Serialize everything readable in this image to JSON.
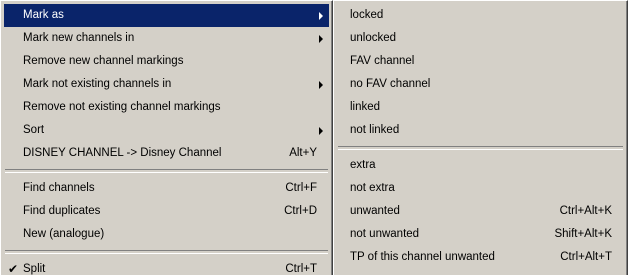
{
  "main_menu": {
    "mark_as": "Mark as",
    "mark_new_channels_in": "Mark new channels in",
    "remove_new_channel_markings": "Remove new channel markings",
    "mark_not_existing_channels_in": "Mark not existing channels in",
    "remove_not_existing_channel_markings": "Remove not existing channel markings",
    "sort": "Sort",
    "rename": {
      "label": "DISNEY CHANNEL -> Disney Channel",
      "shortcut": "Alt+Y"
    },
    "find_channels": {
      "label": "Find channels",
      "shortcut": "Ctrl+F"
    },
    "find_duplicates": {
      "label": "Find duplicates",
      "shortcut": "Ctrl+D"
    },
    "new_analogue": "New (analogue)",
    "split": {
      "label": "Split",
      "shortcut": "Ctrl+T",
      "check_glyph": "✔"
    }
  },
  "submenu": {
    "locked": "locked",
    "unlocked": "unlocked",
    "fav_channel": "FAV channel",
    "no_fav_channel": "no FAV channel",
    "linked": "linked",
    "not_linked": "not linked",
    "extra": "extra",
    "not_extra": "not extra",
    "unwanted": {
      "label": "unwanted",
      "shortcut": "Ctrl+Alt+K"
    },
    "not_unwanted": {
      "label": "not unwanted",
      "shortcut": "Shift+Alt+K"
    },
    "tp_unwanted": {
      "label": "TP of this channel unwanted",
      "shortcut": "Ctrl+Alt+T"
    }
  },
  "colors": {
    "menu_bg": "#d4d0c8",
    "highlight": "#0a246a",
    "highlight_text": "#ffffff"
  }
}
